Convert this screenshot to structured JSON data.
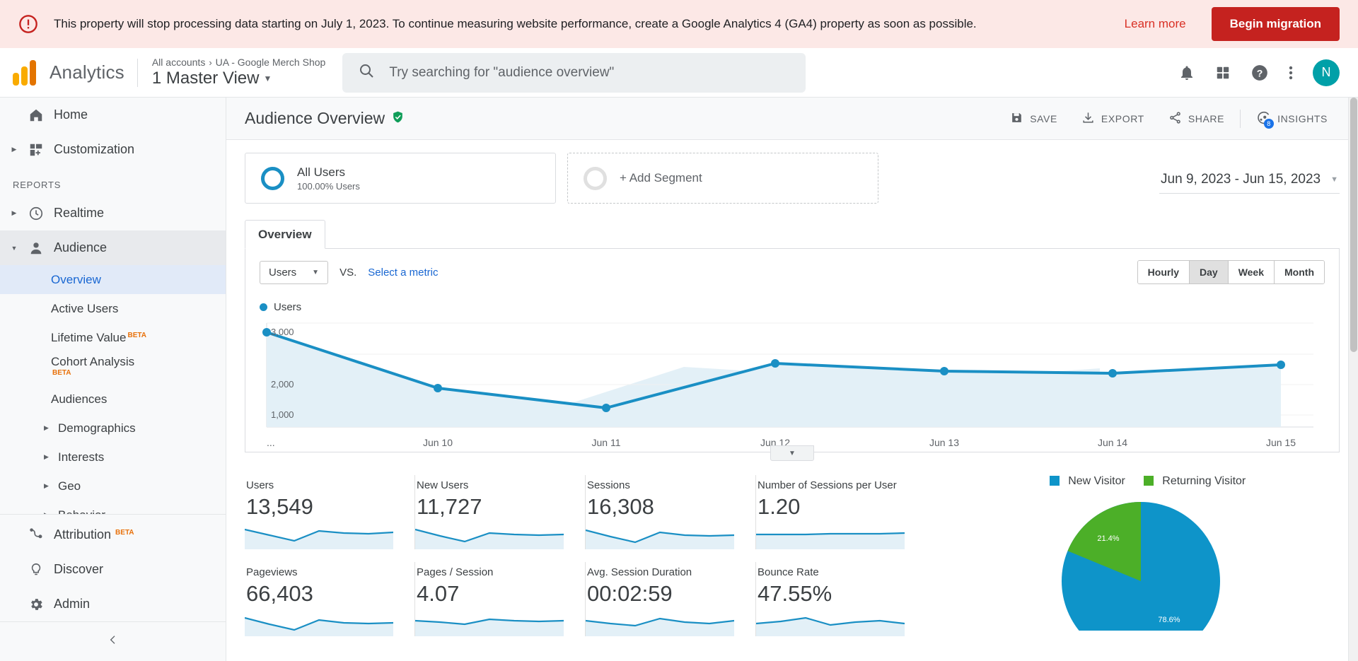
{
  "banner": {
    "icon": "error-outline-icon",
    "message": "This property will stop processing data starting on July 1, 2023. To continue measuring website performance, create a Google Analytics 4 (GA4) property as soon as possible.",
    "learn_more": "Learn more",
    "cta": "Begin migration",
    "bg_color": "#fce8e6",
    "cta_color": "#c5221f"
  },
  "topbar": {
    "product": "Analytics",
    "breadcrumb": {
      "account": "All accounts",
      "separator": "›",
      "property": "UA - Google Merch Shop"
    },
    "view": "1 Master View",
    "search_placeholder": "Try searching for \"audience overview\"",
    "search_value": "",
    "icons": [
      "bell-icon",
      "apps-grid-icon",
      "help-icon",
      "more-vert-icon"
    ],
    "avatar_initial": "N",
    "avatar_color": "#00a0a8"
  },
  "sidebar": {
    "items": [
      {
        "label": "Home",
        "icon": "home-icon",
        "arrow": false
      },
      {
        "label": "Customization",
        "icon": "customization-icon",
        "arrow": true
      }
    ],
    "section_label": "REPORTS",
    "reports": [
      {
        "label": "Realtime",
        "icon": "clock-icon",
        "arrow": true
      },
      {
        "label": "Audience",
        "icon": "person-icon",
        "arrow": true,
        "expanded": true
      }
    ],
    "audience_children": [
      {
        "label": "Overview",
        "selected": true
      },
      {
        "label": "Active Users"
      },
      {
        "label": "Lifetime Value",
        "beta": "BETA"
      },
      {
        "label": "Cohort Analysis",
        "beta": "BETA",
        "beta_below": true
      },
      {
        "label": "Audiences"
      },
      {
        "label": "Demographics",
        "arrow": true
      },
      {
        "label": "Interests",
        "arrow": true
      },
      {
        "label": "Geo",
        "arrow": true
      },
      {
        "label": "Behavior",
        "arrow": true
      }
    ],
    "bottom": [
      {
        "label": "Attribution",
        "icon": "attribution-icon",
        "beta": "BETA"
      },
      {
        "label": "Discover",
        "icon": "bulb-icon"
      },
      {
        "label": "Admin",
        "icon": "gear-icon"
      }
    ],
    "collapse_icon": "chevron-left-icon"
  },
  "report": {
    "title": "Audience Overview",
    "verified_icon": "verified-shield-icon",
    "actions": [
      {
        "label": "SAVE",
        "icon": "save-icon"
      },
      {
        "label": "EXPORT",
        "icon": "download-icon"
      },
      {
        "label": "SHARE",
        "icon": "share-icon"
      },
      {
        "label": "INSIGHTS",
        "icon": "insights-icon",
        "badge": "8"
      }
    ]
  },
  "segments": {
    "applied": {
      "name": "All Users",
      "sub": "100.00% Users",
      "color": "#1a8fc4"
    },
    "add": {
      "label": "+ Add Segment"
    }
  },
  "date_range": {
    "value": "Jun 9, 2023 - Jun 15, 2023",
    "caret": "chevron-down-icon"
  },
  "tabs": [
    {
      "label": "Overview",
      "selected": true
    }
  ],
  "chart_controls": {
    "metric_select": "Users",
    "vs": "VS.",
    "select_metric": "Select a metric",
    "granularity": [
      {
        "label": "Hourly",
        "selected": false
      },
      {
        "label": "Day",
        "selected": true
      },
      {
        "label": "Week",
        "selected": false
      },
      {
        "label": "Month",
        "selected": false
      }
    ]
  },
  "chart_data": {
    "type": "line",
    "title": "",
    "legend": [
      "Users"
    ],
    "legend_position": "top-left",
    "series": [
      {
        "name": "Users",
        "color": "#1a8fc4",
        "values": [
          2990,
          1935,
          1610,
          2350,
          2205,
          2160,
          2290
        ]
      }
    ],
    "x": [
      "...",
      "Jun 10",
      "Jun 11",
      "Jun 12",
      "Jun 13",
      "Jun 14",
      "Jun 15"
    ],
    "xlabel": "",
    "ylabel": "",
    "ylim": [
      0,
      3400
    ],
    "yticks": [
      1000,
      2000,
      3000
    ],
    "ytick_labels": [
      "1,000",
      "2,000",
      "3,000"
    ],
    "grid": true,
    "area_fill": "#e3f0f7"
  },
  "metrics": [
    {
      "label": "Users",
      "value": "13,549",
      "spark": [
        62,
        55,
        42,
        68,
        64,
        62,
        66
      ]
    },
    {
      "label": "New Users",
      "value": "11,727",
      "spark": [
        64,
        54,
        40,
        62,
        60,
        58,
        60
      ]
    },
    {
      "label": "Sessions",
      "value": "16,308",
      "spark": [
        62,
        52,
        38,
        64,
        58,
        56,
        58
      ]
    },
    {
      "label": "Number of Sessions per User",
      "value": "1.20",
      "spark": [
        54,
        54,
        54,
        55,
        55,
        55,
        56
      ]
    },
    {
      "label": "Pageviews",
      "value": "66,403",
      "spark": [
        60,
        50,
        36,
        62,
        56,
        54,
        56
      ]
    },
    {
      "label": "Pages / Session",
      "value": "4.07",
      "spark": [
        56,
        54,
        50,
        58,
        56,
        55,
        56
      ]
    },
    {
      "label": "Avg. Session Duration",
      "value": "00:02:59",
      "spark": [
        56,
        52,
        48,
        60,
        54,
        52,
        56
      ]
    },
    {
      "label": "Bounce Rate",
      "value": "47.55%",
      "spark": [
        52,
        56,
        62,
        50,
        54,
        56,
        52
      ]
    }
  ],
  "pie_chart": {
    "type": "pie",
    "title": "",
    "legend": [
      "New Visitor",
      "Returning Visitor"
    ],
    "categories": [
      "New Visitor",
      "Returning Visitor"
    ],
    "values": [
      78.6,
      21.4
    ],
    "labels": [
      "78.6%",
      "21.4%"
    ],
    "colors": [
      "#0e94c9",
      "#4caf28"
    ],
    "legend_position": "top"
  }
}
